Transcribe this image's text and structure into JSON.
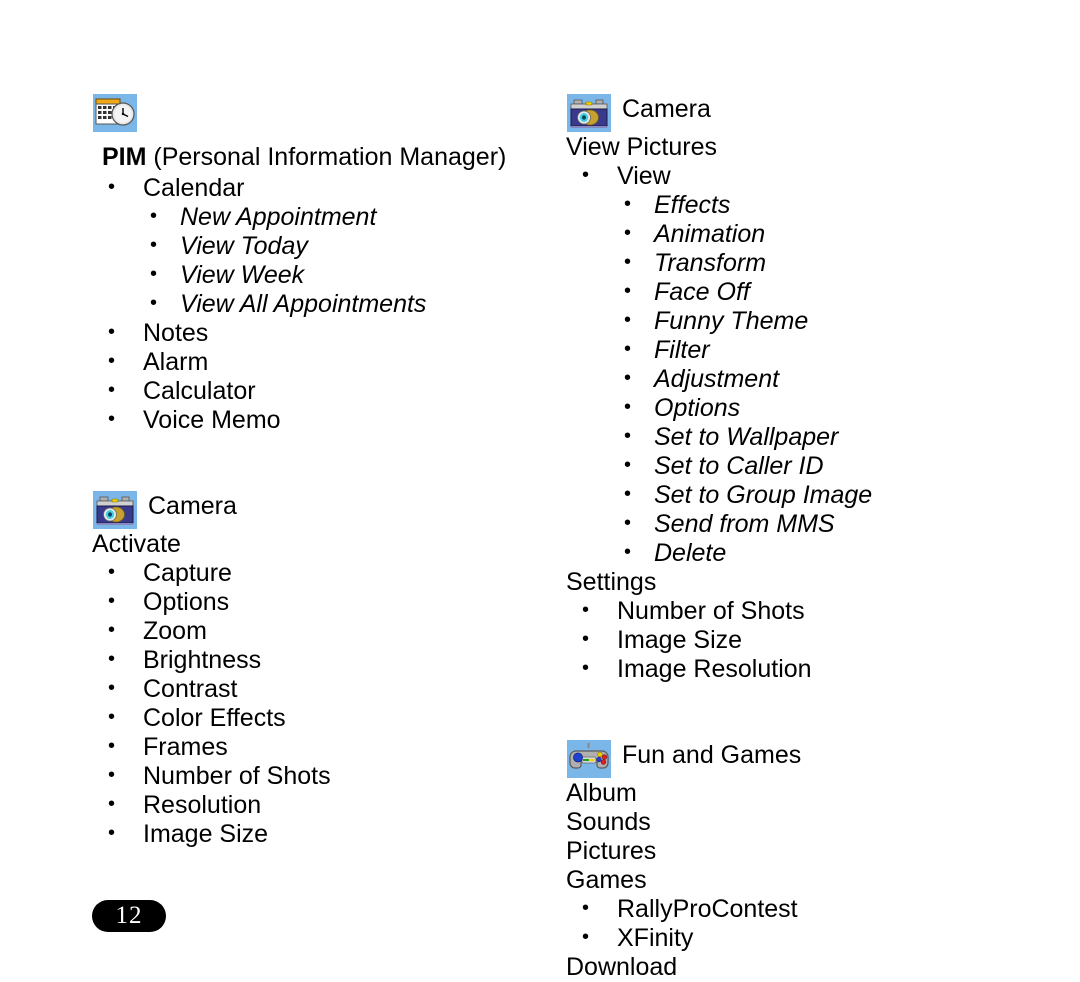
{
  "page": {
    "number": "12",
    "background_color": "#ffffff",
    "text_color": "#000000"
  },
  "left_column": {
    "sections": [
      {
        "icon": "calendar-clock-icon",
        "title_bold": "PIM",
        "title_rest": " (Personal Information Manager)",
        "items": [
          {
            "label": "Calendar",
            "children": [
              "New Appointment",
              "View Today",
              "View Week",
              "View All Appointments"
            ]
          },
          {
            "label": "Notes",
            "children": []
          },
          {
            "label": "Alarm",
            "children": []
          },
          {
            "label": "Calculator",
            "children": []
          },
          {
            "label": "Voice Memo",
            "children": []
          }
        ]
      },
      {
        "icon": "camera-icon",
        "title": "Camera",
        "subheading": "Activate",
        "items": [
          "Capture",
          "Options",
          "Zoom",
          "Brightness",
          "Contrast",
          "Color Effects",
          "Frames",
          "Number of Shots",
          "Resolution",
          "Image Size"
        ]
      }
    ]
  },
  "right_column": {
    "sections": [
      {
        "icon": "camera-icon",
        "title": "Camera",
        "subheading": "View Pictures",
        "view_item": "View",
        "view_children": [
          "Effects",
          "Animation",
          "Transform",
          "Face Off",
          "Funny Theme",
          "Filter",
          "Adjustment",
          "Options",
          "Set to Wallpaper",
          "Set to Caller ID",
          "Set to Group Image",
          "Send from MMS",
          "Delete"
        ],
        "settings_heading": "Settings",
        "settings_items": [
          "Number of Shots",
          "Image Size",
          "Image Resolution"
        ]
      },
      {
        "icon": "gamepad-icon",
        "title": "Fun and Games",
        "plain_lines_top": [
          "Album",
          "Sounds",
          "Pictures",
          "Games"
        ],
        "game_items": [
          "RallyProContest",
          "XFinity"
        ],
        "plain_lines_bottom": [
          "Download"
        ]
      }
    ]
  },
  "colors": {
    "icon_background": "#7ab6e8",
    "calendar_top": "#f0a818",
    "calendar_body": "#ffffff",
    "clock_face": "#e8e8e8",
    "camera_body": "#3a3a8c",
    "camera_top": "#c8c8c8",
    "camera_flash": "#f0d000",
    "camera_lens": "#40d0e0",
    "gamepad_body": "#a8a8a8",
    "gamepad_stick": "#2040d0",
    "gamepad_btn_red": "#e02020",
    "gamepad_btn_yellow": "#f0d000",
    "gamepad_btn_blue": "#2040d0",
    "gamepad_btn_green": "#20a020"
  }
}
